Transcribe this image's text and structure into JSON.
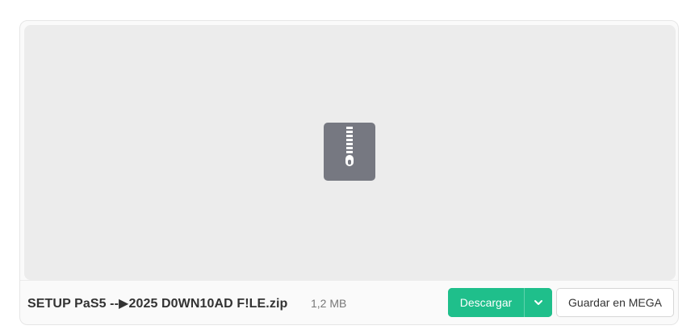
{
  "preview": {
    "icon": "zip-file-icon"
  },
  "file": {
    "name": "SETUP PaS5 --▶2025 D0WN10AD F!LE.zip",
    "size": "1,2 MB"
  },
  "actions": {
    "download_label": "Descargar",
    "download_menu_icon": "chevron-down-icon",
    "save_label": "Guardar en MEGA"
  },
  "colors": {
    "accent": "#1fbf8b",
    "zip_icon_bg": "#767881",
    "preview_bg": "#ececec"
  }
}
